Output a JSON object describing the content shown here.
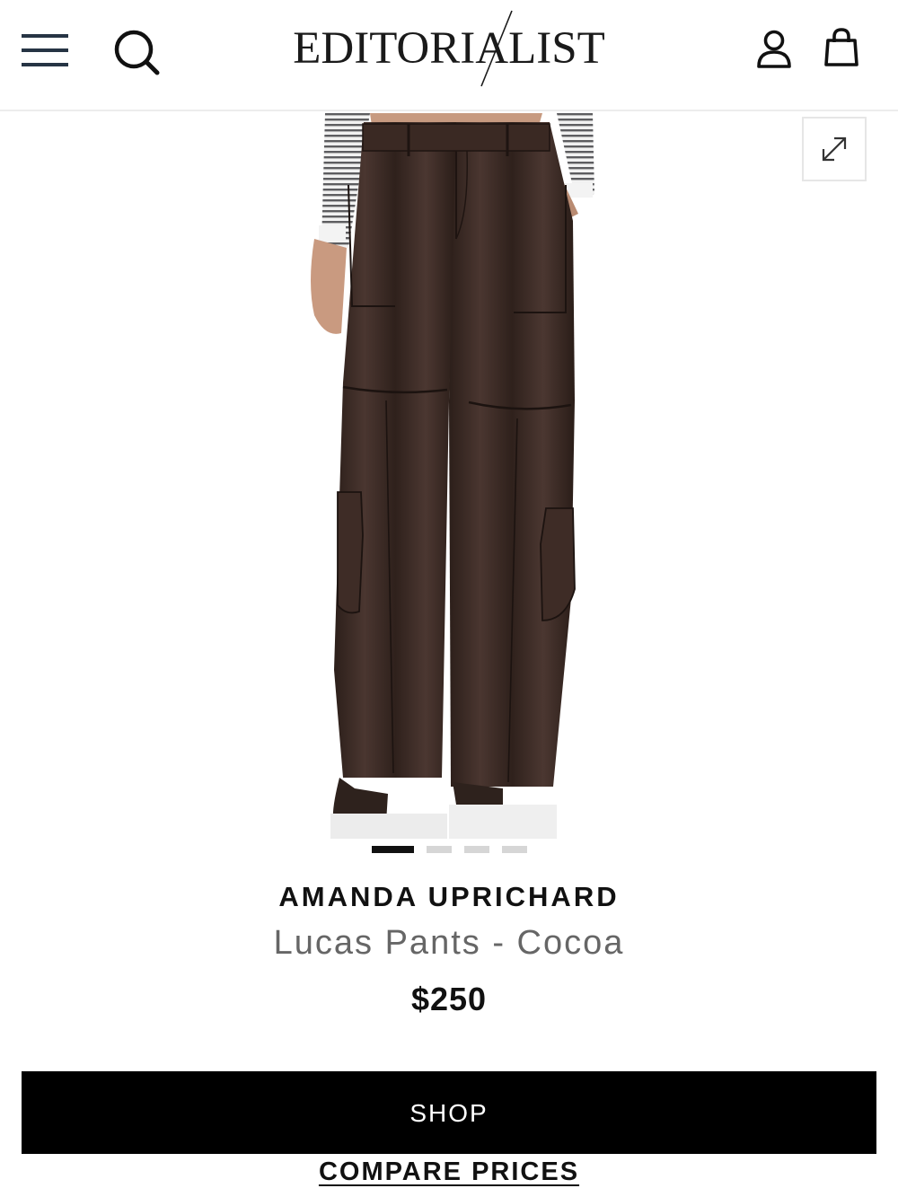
{
  "header": {
    "logo_text": "EDITORIALIST",
    "menu_icon": "hamburger-menu-icon",
    "search_icon": "search-icon",
    "account_icon": "user-account-icon",
    "bag_icon": "shopping-bag-icon"
  },
  "gallery": {
    "expand_icon": "expand-icon",
    "image_count": 4,
    "active_index": 0
  },
  "product": {
    "brand": "AMANDA UPRICHARD",
    "name": "Lucas Pants - Cocoa",
    "price": "$250"
  },
  "actions": {
    "shop_label": "SHOP",
    "compare_label": "COMPARE PRICES"
  },
  "colors": {
    "icon": "#263444",
    "button_bg": "#000000",
    "button_text": "#ffffff",
    "product_name": "#666666",
    "pants": "#3b2a24"
  }
}
